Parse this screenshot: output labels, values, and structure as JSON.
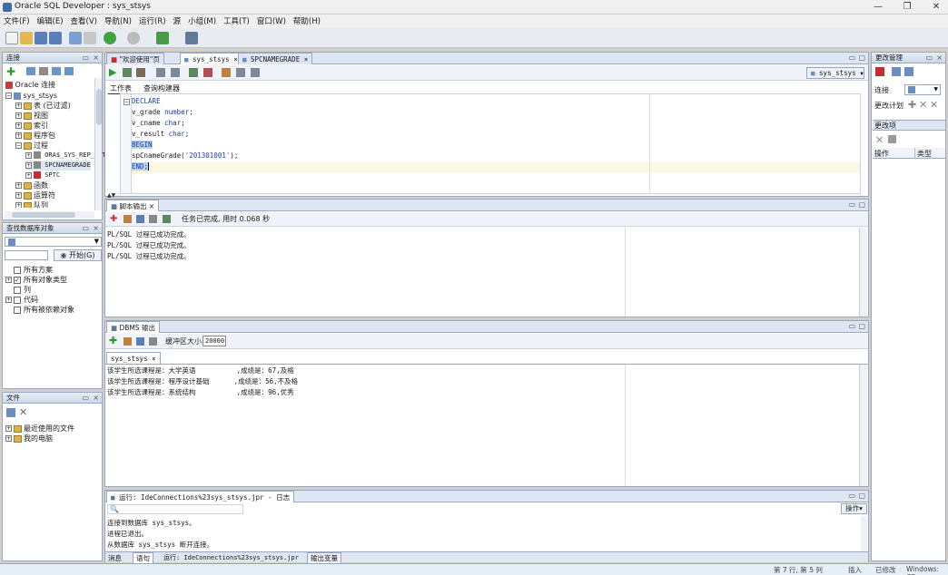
{
  "window": {
    "title": "Oracle SQL Developer : sys_stsys"
  },
  "menu": [
    "文件(F)",
    "编辑(E)",
    "查看(V)",
    "导航(N)",
    "运行(R)",
    "源",
    "小组(M)",
    "工具(T)",
    "窗口(W)",
    "帮助(H)"
  ],
  "connections": {
    "title": "连接",
    "root": "Oracle 连接",
    "items": [
      "sys_stsys",
      "表 (已过滤)",
      "视图",
      "索引",
      "程序包",
      "过程",
      "ORA$_SYS_REP_AUTH",
      "SPCNAMEGRADE",
      "SPTC",
      "函数",
      "运算符",
      "队列"
    ]
  },
  "find": {
    "title": "查找数据库对象",
    "go_label": "开始(G)",
    "options": [
      "所有方案",
      "所有对象类型",
      "列",
      "代码",
      "所有被依赖对象"
    ]
  },
  "files": {
    "title": "文件",
    "items": [
      "最近使用的文件",
      "我的电脑"
    ]
  },
  "editor": {
    "tabs": [
      "\"欢迎使用\"页",
      "sys_stsys",
      "SPCNAMEGRADE"
    ],
    "connection": "sys_stsys",
    "subtabs": [
      "工作表",
      "查询构建器"
    ],
    "code": {
      "l1": "DECLARE",
      "l2a": "v_grade ",
      "l2b": "number",
      "l3a": "v_cname ",
      "l3b": "char",
      "l4a": "v_result ",
      "l4b": "char",
      "l5": "BEGIN",
      "l6a": "spCnameGrade(",
      "l6b": "'201301001'",
      "l6c": ");",
      "l7": "END;",
      "semicolon": ";"
    }
  },
  "script_output": {
    "tab": "脚本输出",
    "status": "任务已完成, 用时 0.068 秒",
    "lines": [
      "PL/SQL 过程已成功完成。",
      "PL/SQL 过程已成功完成。",
      "PL/SQL 过程已成功完成。"
    ]
  },
  "dbms_output": {
    "tab": "DBMS 输出",
    "buffer_label": "缓冲区大小:",
    "buffer_value": "20000",
    "conn_tab": "sys_stsys",
    "lines": [
      "该学生所选课程是：大学英语          ,成绩是：67,及格",
      "该学生所选课程是：程序设计基础      ,成绩是：56,不及格",
      "该学生所选课程是：系统结构          ,成绩是：96,优秀"
    ]
  },
  "log": {
    "tab": "运行: IdeConnections%23sys_stsys.jpr - 日志",
    "action": "操作",
    "lines": [
      "连接到数据库 sys_stsys。",
      "进程已退出。",
      "从数据库 sys_stsys 断开连接。"
    ],
    "bottom_tabs": [
      "消息",
      "语句",
      "运行: IdeConnections%23sys_stsys.jpr",
      "输出变量"
    ]
  },
  "change_mgmt": {
    "title": "更改管理",
    "conn_label": "连接",
    "plan_label": "更改计划",
    "changes_label": "更改项",
    "col1": "操作",
    "col2": "类型"
  },
  "statusbar": {
    "pos": "第 7 行, 第 5 列",
    "mode": "插入",
    "modified": "已修改",
    "os": "Windows: CR"
  }
}
